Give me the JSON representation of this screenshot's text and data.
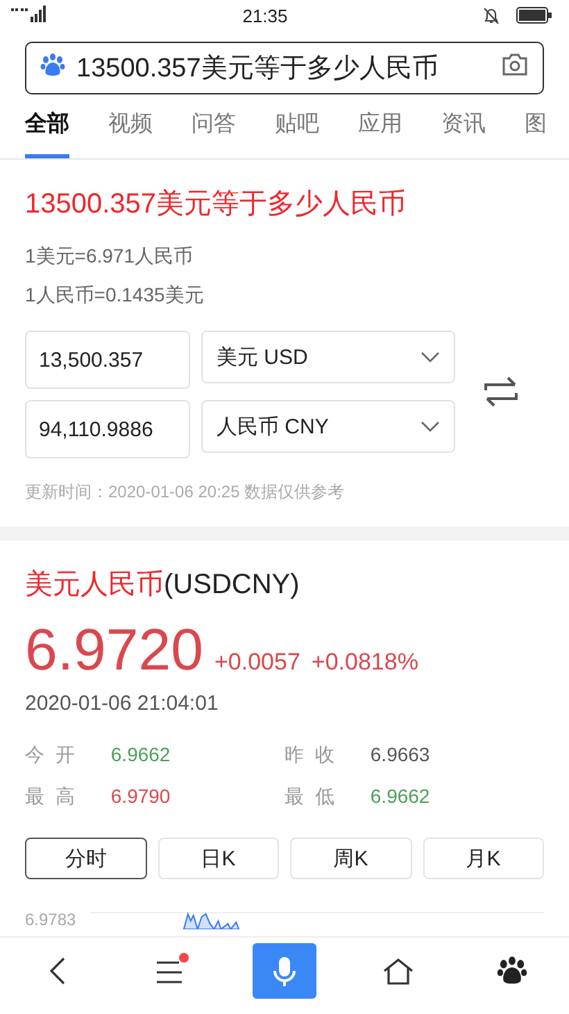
{
  "status_bar": {
    "time": "21:35"
  },
  "search": {
    "value": "13500.357美元等于多少人民币"
  },
  "tabs": [
    {
      "label": "全部",
      "selected": true
    },
    {
      "label": "视频",
      "selected": false
    },
    {
      "label": "问答",
      "selected": false
    },
    {
      "label": "贴吧",
      "selected": false
    },
    {
      "label": "应用",
      "selected": false
    },
    {
      "label": "资讯",
      "selected": false
    },
    {
      "label": "图",
      "selected": false
    }
  ],
  "converter": {
    "title": "13500.357美元等于多少人民币",
    "rates": [
      "1美元=6.971人民币",
      "1人民币=0.1435美元"
    ],
    "rows": [
      {
        "amount": "13,500.357",
        "currency": "美元 USD"
      },
      {
        "amount": "94,110.9886",
        "currency": "人民币 CNY"
      }
    ],
    "note": "更新时间：2020-01-06 20:25 数据仅供参考"
  },
  "quote": {
    "name": "美元人民币",
    "code": "(USDCNY)",
    "price": "6.9720",
    "change": "+0.0057",
    "change_pct": "+0.0818%",
    "time": "2020-01-06 21:04:01",
    "stats": [
      {
        "label": "今 开",
        "value": "6.9662",
        "color": "#4aa05a"
      },
      {
        "label": "昨 收",
        "value": "6.9663",
        "color": "#555555"
      },
      {
        "label": "最 高",
        "value": "6.9790",
        "color": "#d9484e"
      },
      {
        "label": "最 低",
        "value": "6.9662",
        "color": "#4aa05a"
      }
    ],
    "periods": [
      {
        "label": "分时",
        "selected": true
      },
      {
        "label": "日K",
        "selected": false
      },
      {
        "label": "周K",
        "selected": false
      },
      {
        "label": "月K",
        "selected": false
      }
    ],
    "chart_top_label": "6.9783"
  },
  "bottom_nav": [
    {
      "kind": "back"
    },
    {
      "kind": "menu",
      "badge": true
    },
    {
      "kind": "voice"
    },
    {
      "kind": "home"
    },
    {
      "kind": "paw"
    }
  ]
}
